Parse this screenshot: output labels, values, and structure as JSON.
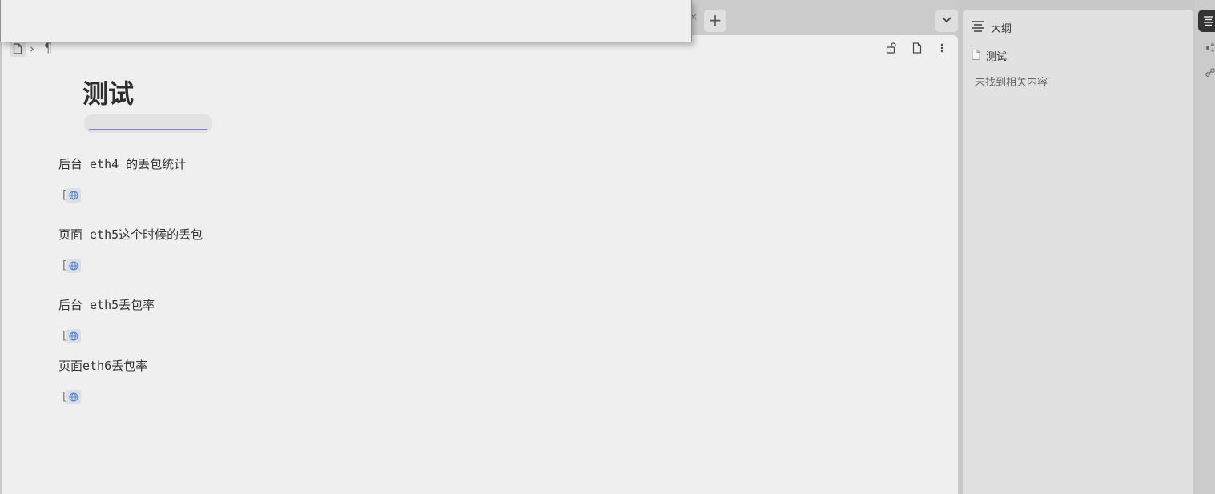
{
  "tabbar": {
    "add_tab_label": "+",
    "close_fragment": "×"
  },
  "breadcrumb": {
    "separator": "›",
    "para_symbol": "¶"
  },
  "document": {
    "title": "测试",
    "title_field_value": "",
    "items": [
      {
        "text": "后台 eth4 的丢包统计"
      },
      {
        "text": "页面 eth5这个时候的丢包"
      },
      {
        "text": "后台 eth5丢包率"
      },
      {
        "text": "页面eth6丢包率"
      }
    ],
    "link_bracket": "["
  },
  "outline_panel": {
    "title": "大纲",
    "doc_name": "测试",
    "empty_message": "未找到相关内容"
  },
  "colors": {
    "link_chip_bg": "#dcdfe6",
    "title_underline": "#8d7ccf",
    "globe_blue": "#4a7fd6"
  }
}
